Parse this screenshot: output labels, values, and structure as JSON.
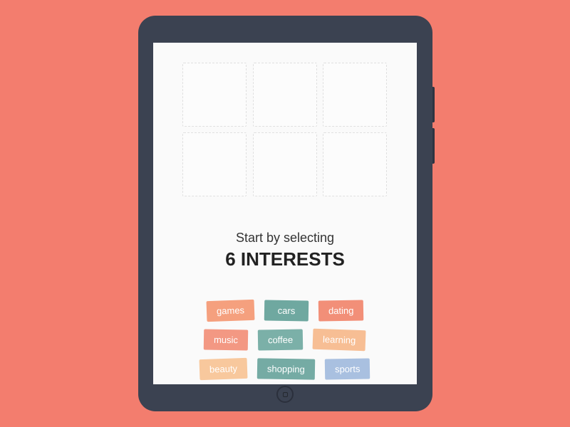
{
  "prompt": {
    "top": "Start by selecting",
    "main": "6 INTERESTS"
  },
  "slots": 6,
  "tags": [
    {
      "key": "games",
      "label": "games"
    },
    {
      "key": "cars",
      "label": "cars"
    },
    {
      "key": "dating",
      "label": "dating"
    },
    {
      "key": "music",
      "label": "music"
    },
    {
      "key": "coffee",
      "label": "coffee"
    },
    {
      "key": "learning",
      "label": "learning"
    },
    {
      "key": "beauty",
      "label": "beauty"
    },
    {
      "key": "shopping",
      "label": "shopping"
    },
    {
      "key": "sports",
      "label": "sports"
    }
  ]
}
